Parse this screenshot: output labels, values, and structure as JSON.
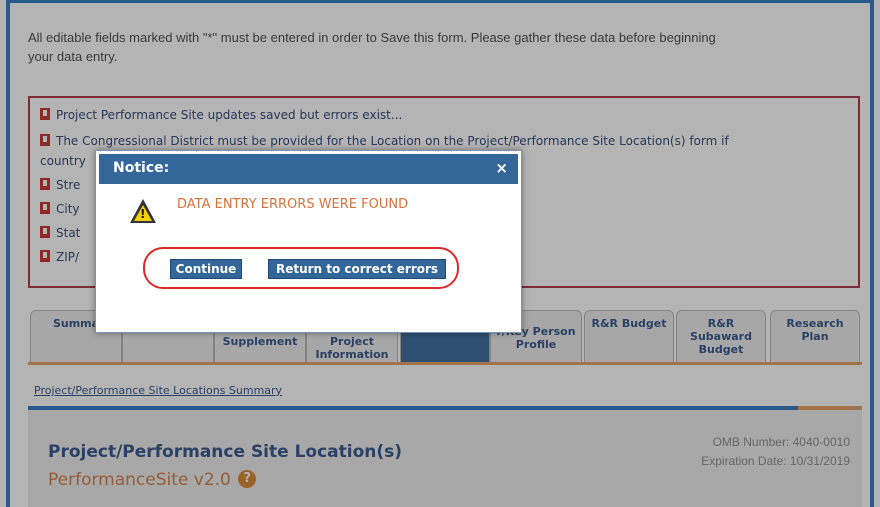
{
  "intro": {
    "line1": "All editable fields marked with \"*\" must be entered in order to Save this form.  Please gather these data before beginning",
    "line2": "your data entry."
  },
  "errors": [
    "Project Performance Site updates saved but errors exist...",
    "The Congressional District must be provided for the Location on the Project/Performance Site Location(s) form if",
    "country",
    "Stre",
    "City",
    "Stat",
    "ZIP/"
  ],
  "tabs": [
    {
      "label": "Summa"
    },
    {
      "label": ""
    },
    {
      "label": "Supplement"
    },
    {
      "label": "Project Information"
    },
    {
      "label": ""
    },
    {
      "label": "r/Key Person Profile"
    },
    {
      "label": "R&R Budget"
    },
    {
      "label": "R&R Subaward Budget"
    },
    {
      "label": "Research Plan"
    }
  ],
  "breadcrumb": "Project/Performance Site Locations Summary",
  "form": {
    "title": "Project/Performance Site Location(s)",
    "subtitle": "PerformanceSite v2.0",
    "help": "?",
    "omb": "OMB Number: 4040-0010",
    "expiration": "Expiration Date: 10/31/2019"
  },
  "dialog": {
    "title": "Notice:",
    "close": "×",
    "message": "DATA ENTRY ERRORS WERE FOUND",
    "warn_mark": "!",
    "continue_label": "Continue",
    "return_label": "Return to correct errors"
  },
  "colors": {
    "header_blue": "#336699",
    "error_red": "#a8323a",
    "accent_orange": "#d9713a"
  }
}
